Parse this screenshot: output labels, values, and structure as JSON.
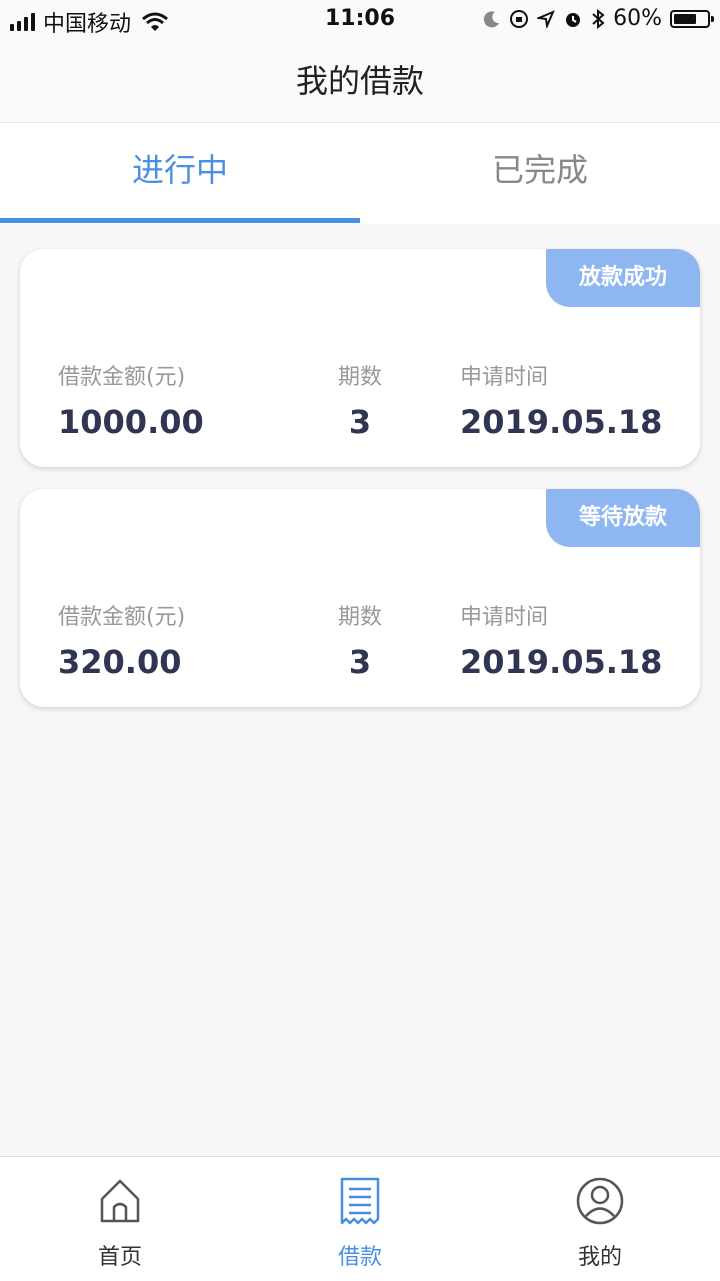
{
  "status_bar": {
    "carrier": "中国移动",
    "time": "11:06",
    "battery": "60%",
    "battery_level": 0.6
  },
  "header": {
    "title": "我的借款"
  },
  "tabs": [
    {
      "label": "进行中",
      "active": true
    },
    {
      "label": "已完成",
      "active": false
    }
  ],
  "loans": [
    {
      "status": "放款成功",
      "amount_label": "借款金额(元)",
      "amount": "1000.00",
      "periods_label": "期数",
      "periods": "3",
      "date_label": "申请时间",
      "date": "2019.05.18"
    },
    {
      "status": "等待放款",
      "amount_label": "借款金额(元)",
      "amount": "320.00",
      "periods_label": "期数",
      "periods": "3",
      "date_label": "申请时间",
      "date": "2019.05.18"
    }
  ],
  "bottom_nav": [
    {
      "label": "首页",
      "icon": "home-icon",
      "active": false
    },
    {
      "label": "借款",
      "icon": "receipt-icon",
      "active": true
    },
    {
      "label": "我的",
      "icon": "user-icon",
      "active": false
    }
  ],
  "colors": {
    "accent": "#4a90e2",
    "badge": "#8eb6f0",
    "value_text": "#2f3552"
  }
}
